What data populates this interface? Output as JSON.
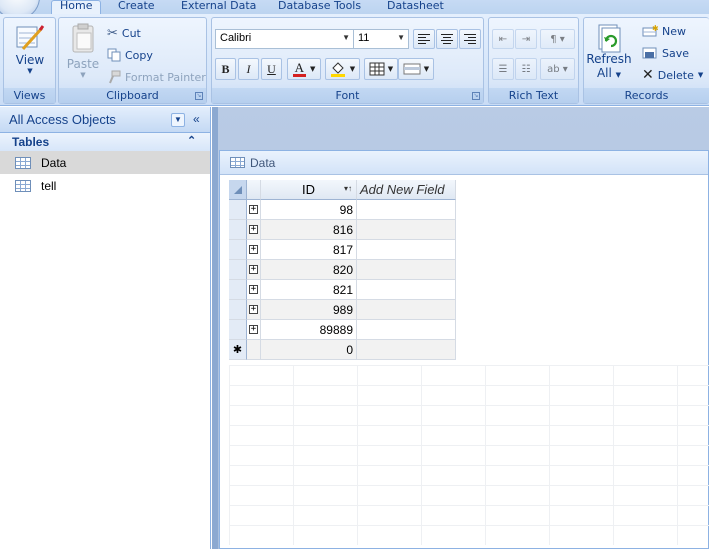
{
  "tabs": [
    {
      "label": "Home",
      "active": true
    },
    {
      "label": "Create"
    },
    {
      "label": "External Data"
    },
    {
      "label": "Database Tools"
    },
    {
      "label": "Datasheet"
    }
  ],
  "ribbon": {
    "views": {
      "label": "Views",
      "view_button": "View"
    },
    "clipboard": {
      "label": "Clipboard",
      "paste": "Paste",
      "cut": "Cut",
      "copy": "Copy",
      "format_painter": "Format Painter"
    },
    "font": {
      "label": "Font",
      "font_name": "Calibri",
      "font_size": "11",
      "bold": "B",
      "italic": "I",
      "underline": "U",
      "font_color": "A"
    },
    "rich_text": {
      "label": "Rich Text"
    },
    "records": {
      "label": "Records",
      "refresh_line1": "Refresh",
      "refresh_line2": "All",
      "new": "New",
      "save": "Save",
      "delete": "Delete"
    }
  },
  "nav": {
    "title": "All Access Objects",
    "group": "Tables",
    "items": [
      {
        "label": "Data",
        "selected": true
      },
      {
        "label": "tell",
        "selected": false
      }
    ]
  },
  "document": {
    "title": "Data",
    "columns": [
      "ID",
      "Add New Field"
    ],
    "rows": [
      "98",
      "816",
      "817",
      "820",
      "821",
      "989",
      "89889"
    ],
    "new_row_value": "0",
    "new_row_marker": "✱"
  }
}
